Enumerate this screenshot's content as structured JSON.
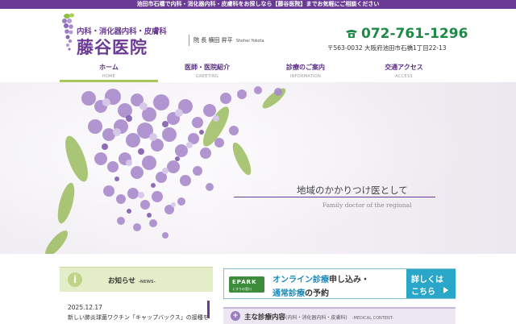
{
  "topbar": {
    "text": "池田市石橋で内科・消化器内科・皮膚科をお探しなら【藤谷医院】までお気軽にご相談ください"
  },
  "header": {
    "logo_sub": "内科・消化器内科・皮膚科",
    "logo_main": "藤谷医院",
    "director_label": "院 長 横田 昇平",
    "director_roman": "Shohei Yokota",
    "phone": "072-761-1296",
    "address": "〒563-0032 大阪府池田市石橋1丁目22-13"
  },
  "nav": {
    "items": [
      {
        "label": "ホーム",
        "en": "HOME",
        "active": true
      },
      {
        "label": "医師・医院紹介",
        "en": "GREETING",
        "active": false
      },
      {
        "label": "診療のご案内",
        "en": "INFORMATION",
        "active": false
      },
      {
        "label": "交通アクセス",
        "en": "ACCESS",
        "active": false
      }
    ]
  },
  "hero": {
    "tagline": "地域のかかりつけ医として",
    "tagline_en": "Family doctor of the regional"
  },
  "news": {
    "title": "お知らせ",
    "title_en": "-NEWS-",
    "date": "2025.12.17",
    "text": "新しい肺炎球菌ワクチン「キャップバックス」の接種を"
  },
  "epark": {
    "logo": "EPARK",
    "logo_sub": "くすりの窓口",
    "line1_accent": "オンライン診療",
    "line1_rest": "申し込み・",
    "line2_accent": "通常診療",
    "line2_rest": "の予約",
    "btn_line1": "詳しくは",
    "btn_line2": "こちら"
  },
  "services": {
    "title": "主な診療内容",
    "sub": "(内科・消化器内科・皮膚科)",
    "en": "-MEDICAL CONTENT-"
  },
  "colors": {
    "brand_purple": "#6a3a94",
    "phone_green": "#1f8a46",
    "news_green": "#e3edc8",
    "epark_blue": "#2aa6c8"
  }
}
